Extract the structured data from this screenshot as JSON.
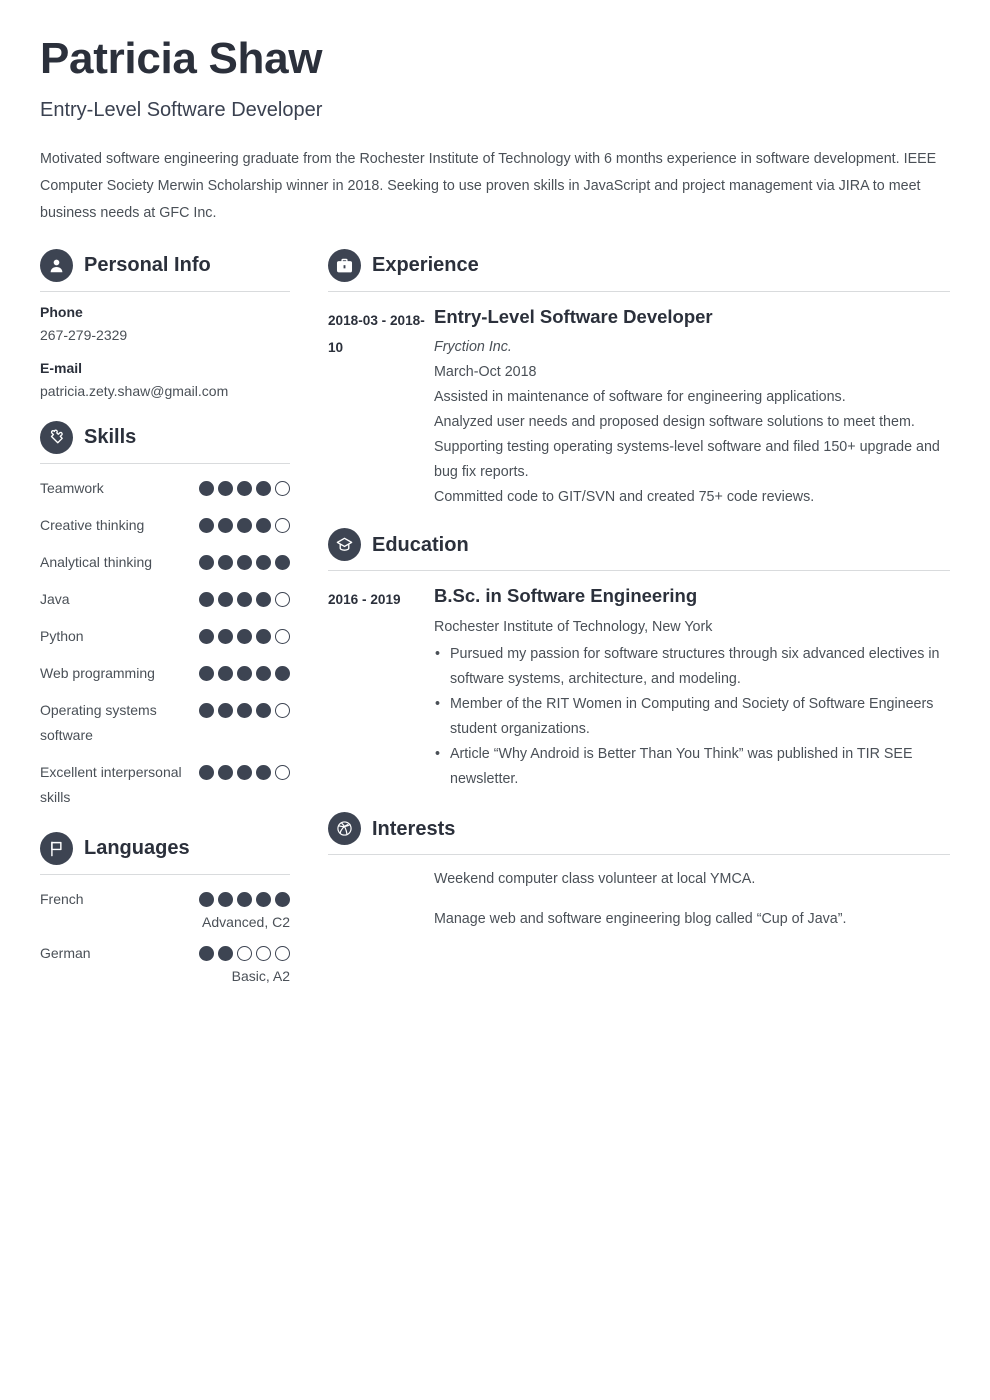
{
  "header": {
    "name": "Patricia Shaw",
    "job_title": "Entry-Level Software Developer",
    "summary": "Motivated software engineering graduate from the Rochester Institute of Technology with 6 months experience in software development. IEEE Computer Society Merwin Scholarship winner in 2018. Seeking to use proven skills in JavaScript and project management via JIRA to meet business needs at GFC Inc."
  },
  "colors": {
    "accent": "#3d4452",
    "heading": "#2b303b",
    "body": "#4a5057",
    "rule": "#d9dbdd"
  },
  "personal_info": {
    "section_title": "Personal Info",
    "icon": "person-icon",
    "fields": [
      {
        "label": "Phone",
        "value": "267-279-2329"
      },
      {
        "label": "E-mail",
        "value": "patricia.zety.shaw@gmail.com"
      }
    ]
  },
  "skills": {
    "section_title": "Skills",
    "icon": "puzzle-piece-icon",
    "max_rating": 5,
    "items": [
      {
        "label": "Teamwork",
        "rating": 4
      },
      {
        "label": "Creative thinking",
        "rating": 4
      },
      {
        "label": "Analytical thinking",
        "rating": 5
      },
      {
        "label": "Java",
        "rating": 4
      },
      {
        "label": "Python",
        "rating": 4
      },
      {
        "label": "Web programming",
        "rating": 5
      },
      {
        "label": "Operating systems software",
        "rating": 4
      },
      {
        "label": "Excellent interpersonal skills",
        "rating": 4
      }
    ]
  },
  "languages": {
    "section_title": "Languages",
    "icon": "flag-icon",
    "max_rating": 5,
    "items": [
      {
        "label": "French",
        "rating": 5,
        "level": "Advanced, C2"
      },
      {
        "label": "German",
        "rating": 2,
        "level": "Basic, A2"
      }
    ]
  },
  "experience": {
    "section_title": "Experience",
    "icon": "briefcase-icon",
    "entries": [
      {
        "date": "2018-03 - 2018-10",
        "title": "Entry-Level Software Developer",
        "company": "Fryction Inc.",
        "period": "March-Oct 2018",
        "lines": [
          "Assisted in maintenance of software for engineering applications.",
          "Analyzed user needs and proposed design software solutions to meet them.",
          "Supporting testing operating systems-level software and filed 150+ upgrade and bug fix reports.",
          "Committed code to GIT/SVN and created 75+ code reviews."
        ]
      }
    ]
  },
  "education": {
    "section_title": "Education",
    "icon": "graduation-cap-icon",
    "entries": [
      {
        "date": "2016 - 2019",
        "title": "B.Sc. in Software Engineering",
        "school": "Rochester Institute of Technology, New York",
        "bullets": [
          "Pursued my passion for software structures through six advanced electives in software systems, architecture, and modeling.",
          "Member of the RIT Women in Computing and Society of Software Engineers student organizations.",
          "Article “Why Android is Better Than You Think” was published in TIR SEE newsletter."
        ]
      }
    ]
  },
  "interests": {
    "section_title": "Interests",
    "icon": "globe-ball-icon",
    "items": [
      "Weekend computer class volunteer at local YMCA.",
      "Manage web and software engineering blog called “Cup of Java”."
    ]
  }
}
